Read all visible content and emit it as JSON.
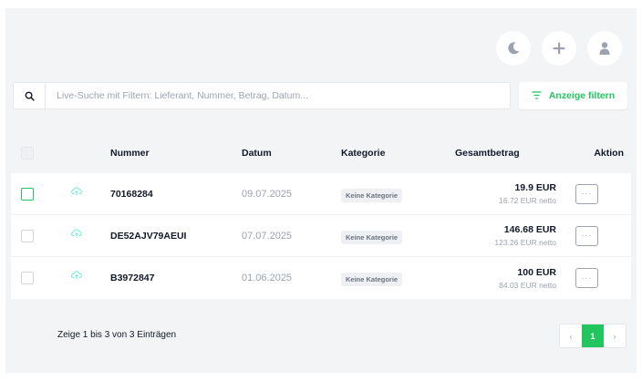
{
  "header": {
    "buttons": [
      {
        "name": "dark-mode-button",
        "icon": "moon-icon"
      },
      {
        "name": "add-button",
        "icon": "plus-icon"
      },
      {
        "name": "user-button",
        "icon": "user-icon"
      }
    ]
  },
  "search": {
    "placeholder": "Live-Suche mit Filtern: Lieferant, Nummer, Betrag, Datum...",
    "value": ""
  },
  "filter": {
    "label": "Anzeige filtern"
  },
  "table": {
    "columns": {
      "number": "Nummer",
      "date": "Datum",
      "category": "Kategorie",
      "total": "Gesamtbetrag",
      "action": "Aktion"
    },
    "rows": [
      {
        "number": "70168284",
        "date": "09.07.2025",
        "category": "Keine Kategorie",
        "gross": "19.9 EUR",
        "net": "16.72 EUR netto",
        "action": "···"
      },
      {
        "number": "DE52AJV79AEUI",
        "date": "07.07.2025",
        "category": "Keine Kategorie",
        "gross": "146.68 EUR",
        "net": "123.26 EUR netto",
        "action": "···"
      },
      {
        "number": "B3972847",
        "date": "01.06.2025",
        "category": "Keine Kategorie",
        "gross": "100 EUR",
        "net": "84.03 EUR netto",
        "action": "···"
      }
    ]
  },
  "footer": {
    "summary": "Zeige 1 bis 3 von 3 Einträgen",
    "pagination": {
      "prev": "‹",
      "current": "1",
      "next": "›"
    }
  },
  "colors": {
    "accent": "#22c55e",
    "background": "#f3f4f6",
    "muted": "#9ca3af"
  }
}
